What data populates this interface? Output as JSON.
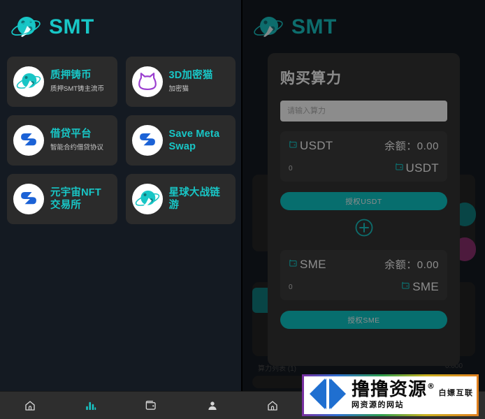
{
  "app": {
    "brand_name": "SMT",
    "logo_icon": "planet-rocket-icon"
  },
  "left_panel": {
    "dapps": [
      {
        "title": "质押铸币",
        "subtitle": "质押SMT铸主流币",
        "icon": "planet-rocket-icon"
      },
      {
        "title": "3D加密猫",
        "subtitle": "加密猫",
        "icon": "crypto-cat-icon"
      },
      {
        "title": "借贷平台",
        "subtitle": "智能合约借贷协议",
        "icon": "save-swap-icon"
      },
      {
        "title": "Save Meta Swap",
        "subtitle": "",
        "icon": "save-swap-icon"
      },
      {
        "title": "元宇宙NFT交易所",
        "subtitle": "",
        "icon": "save-swap-icon"
      },
      {
        "title": "星球大战链游",
        "subtitle": "",
        "icon": "planet-rocket-icon"
      }
    ]
  },
  "right_panel": {
    "modal": {
      "title": "购买算力",
      "input_placeholder": "请输入算力",
      "input_value": "",
      "usdt": {
        "symbol": "USDT",
        "balance_label": "余额：",
        "balance_value": "0.00",
        "amount": "0",
        "unit": "USDT",
        "auth_button": "授权USDT"
      },
      "add_icon": "plus-circle-icon",
      "sme": {
        "symbol": "SME",
        "balance_label": "余额：",
        "balance_value": "0.00",
        "amount": "0",
        "unit": "SME",
        "auth_button": "授权SME"
      }
    }
  },
  "tabbar": {
    "items": [
      {
        "icon": "home-icon",
        "active": false
      },
      {
        "icon": "chart-icon",
        "active": true
      },
      {
        "icon": "wallet-icon",
        "active": false
      },
      {
        "icon": "person-icon",
        "active": false
      }
    ]
  },
  "watermark": {
    "title": "撸撸资源",
    "registered_mark": "®",
    "subtitle": "白嫖互联网资源的网站",
    "logo_icon": "arrows-logo-icon"
  },
  "colors": {
    "accent_teal": "#18c6c6",
    "button_teal": "#0ec9c9",
    "page_bg": "#141a22",
    "card_bg": "#2b2b2b",
    "modal_bg": "#333333",
    "token_bg": "#3d3d3d",
    "tabbar_bg": "#2e2e2e",
    "cat_purple": "#9b3fd0",
    "swap_blue": "#1b62d6"
  }
}
